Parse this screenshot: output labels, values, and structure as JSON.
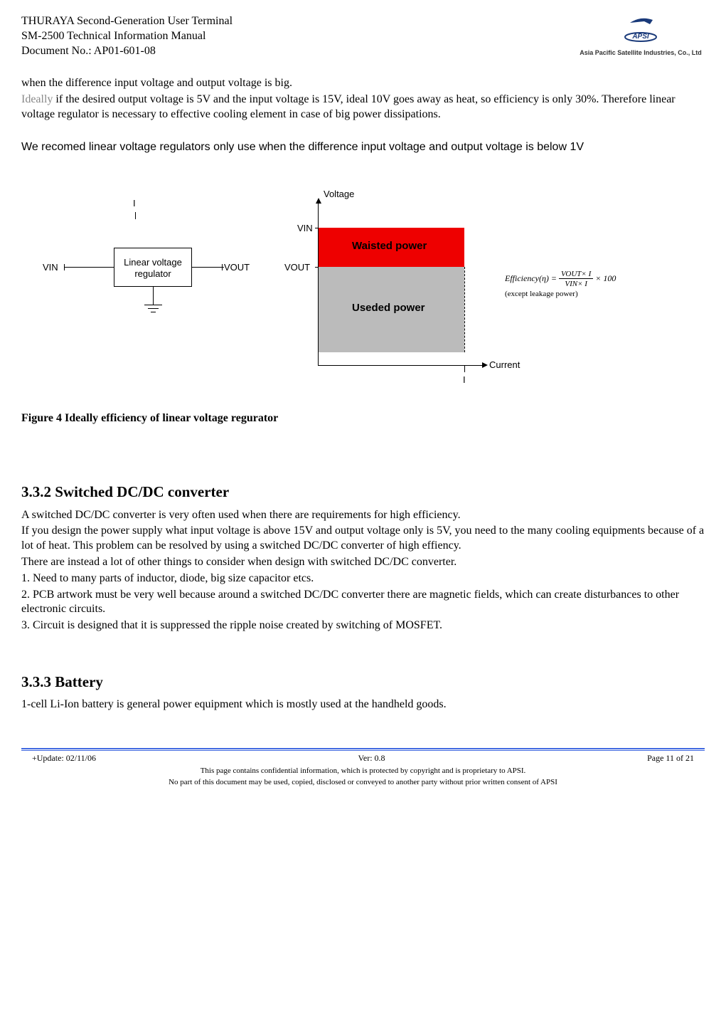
{
  "header": {
    "line1": "THURAYA Second-Generation User Terminal",
    "line2": "SM-2500 Technical Information Manual",
    "line3": "Document No.: AP01-601-08",
    "logo_text": "Asia Pacific Satellite Industries, Co., Ltd"
  },
  "intro": {
    "p1": "when the difference input voltage and output voltage is big.",
    "ideally_word": "Ideally",
    "p2_rest": " if the desired output voltage is 5V and the input voltage is 15V, ideal 10V goes away as heat, so efficiency is only 30%. Therefore linear voltage regulator is necessary to effective cooling element in case of big power dissipations.",
    "p3": "We recomed linear voltage regulators only use when the difference input voltage and output voltage is below 1V"
  },
  "diagram": {
    "vin_left": "VIN",
    "regulator": "Linear voltage regulator",
    "vout_left": "VOUT",
    "voltage_label": "Voltage",
    "vin_axis": "VIN",
    "vout_axis": "VOUT",
    "waisted": "Waisted power",
    "useded": "Useded power",
    "current_label": "Current",
    "i_label": "I",
    "efficiency_lhs": "Efficiency(η) =",
    "frac_top": "VOUT× I",
    "frac_bot": "VIN× I",
    "times_100": "× 100",
    "except_note": "(except leakage power)"
  },
  "figure_caption": "Figure 4 Ideally efficiency of linear voltage regurator",
  "section_332": {
    "heading": "3.3.2  Switched DC/DC converter",
    "p1": "A switched DC/DC converter is very often used when there are requirements for high efficiency.",
    "p2": "If you design the power supply what input voltage is above 15V and output voltage only is 5V, you need to the many cooling equipments because of a lot of heat. This problem can be resolved by using a switched DC/DC converter of high effiency.",
    "p3": "There are instead a lot of other things to consider when design with switched DC/DC converter.",
    "li1": "1. Need to many parts of inductor, diode, big size capacitor etcs.",
    "li2": "2. PCB artwork must be very well because around a switched DC/DC converter there are magnetic fields, which can create disturbances to other electronic circuits.",
    "li3": "3. Circuit is designed that it is suppressed the ripple noise created by switching of MOSFET."
  },
  "section_333": {
    "heading": "3.3.3  Battery",
    "p1": "1-cell Li-Ion battery is general power equipment which is mostly used at the handheld goods."
  },
  "footer": {
    "update": "+Update: 02/11/06",
    "ver": "Ver: 0.8",
    "page": "Page 11 of 21",
    "note1": "This page contains confidential information, which is protected by copyright and is proprietary to APSI.",
    "note2": "No part of this document may be used, copied, disclosed or conveyed to another party without prior written consent of APSI"
  },
  "chart_data": {
    "type": "bar",
    "title": "Ideally efficiency of linear voltage regurator",
    "xlabel": "Current",
    "ylabel": "Voltage",
    "categories": [
      "I"
    ],
    "series": [
      {
        "name": "Useded power",
        "range": [
          0,
          "VOUT"
        ]
      },
      {
        "name": "Waisted power",
        "range": [
          "VOUT",
          "VIN"
        ]
      }
    ],
    "y_ticks": [
      "VOUT",
      "VIN"
    ],
    "annotations": [
      "Efficiency(η) = (VOUT × I) / (VIN × I) × 100 (except leakage power)"
    ]
  }
}
